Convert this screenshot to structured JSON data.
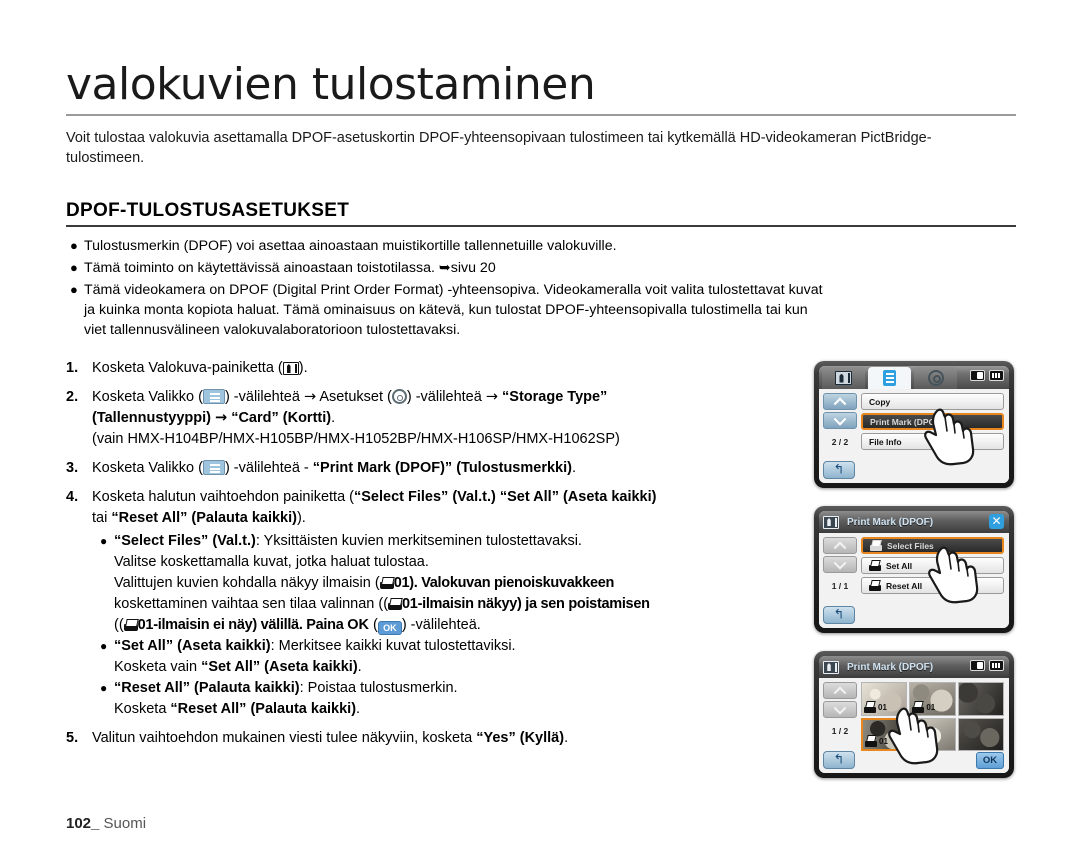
{
  "page": {
    "title": "valokuvien tulostaminen",
    "intro": "Voit tulostaa valokuvia asettamalla DPOF-asetuskortin DPOF-yhteensopivaan tulostimeen tai kytkemällä HD-videokameran PictBridge-tulostimeen.",
    "section_heading": "DPOF-TULOSTUSASETUKSET",
    "footer_number": "102_",
    "footer_language": "Suomi"
  },
  "bullets": [
    "Tulostusmerkin (DPOF) voi asettaa ainoastaan muistikortille tallennetuille valokuville.",
    "Tämä toiminto on käytettävissä ainoastaan toistotilassa. ➥sivu 20",
    "Tämä videokamera on DPOF (Digital Print Order Format) -yhteensopiva. Videokameralla voit valita tulostettavat kuvat ja kuinka monta kopiota haluat. Tämä ominaisuus on kätevä, kun tulostat DPOF-yhteensopivalla tulostimella tai kun viet tallennusvälineen valokuvalaboratorioon tulostettavaksi."
  ],
  "steps": {
    "s1": {
      "num": "1.",
      "a": "Kosketa Valokuva-painiketta (",
      "b": ")."
    },
    "s2": {
      "num": "2.",
      "a": "Kosketa Valikko (",
      "b": ") -välilehteä ",
      "arrow1": "→",
      "c": " Asetukset (",
      "d": ") -välilehteä ",
      "arrow2": "→",
      "e": " ",
      "bold1": "“Storage Type”",
      "bold2": "(Tallennustyyppi)",
      "arrow3": "→",
      "bold3": "“Card”",
      "bold4": "(Kortti)",
      "dot": ".",
      "models": "(vain HMX-H104BP/HMX-H105BP/HMX-H1052BP/HMX-H106SP/HMX-H1062SP)"
    },
    "s3": {
      "num": "3.",
      "a": "Kosketa Valikko (",
      "b": ") -välilehteä - ",
      "bold1": "“Print Mark (DPOF)”",
      "bold2": "(Tulostusmerkki)",
      "dot": "."
    },
    "s4": {
      "num": "4.",
      "a": "Kosketa halutun vaihtoehdon painiketta (",
      "bold1": "“Select Files” (Val.t.)",
      "bold2": "“Set All” (Aseta kaikki)",
      "mid": " tai ",
      "bold3": "“Reset All” (Palauta kaikki)",
      "end": ").",
      "sub": [
        {
          "bold": "“Select Files” (Val.t.)",
          "rest": ": Yksittäisten kuvien merkitseminen tulostettavaksi.",
          "line2": "Valitse koskettamalla kuvat, jotka haluat tulostaa.",
          "line3a": "Valittujen kuvien kohdalla näkyy ilmaisin (",
          "line3b": "01). Valokuvan pienoiskuvakkeen",
          "line4a": "koskettaminen vaihtaa sen tilaa valinnan ((",
          "line4b": "01-ilmaisin näkyy) ja sen poistamisen",
          "line5a": "((",
          "line5b": "01-ilmaisin ei näy) välillä. Paina ",
          "line5bold": "OK",
          "line5c": " (",
          "line5d": ") -välilehteä."
        },
        {
          "bold": "“Set All” (Aseta kaikki)",
          "rest": ": Merkitsee kaikki kuvat tulostettaviksi.",
          "line2a": "Kosketa vain ",
          "line2bold": "“Set All” (Aseta kaikki)",
          "line2c": "."
        },
        {
          "bold": "“Reset All” (Palauta kaikki)",
          "rest": ": Poistaa tulostusmerkin.",
          "line2a": "Kosketa ",
          "line2bold": "“Reset All” (Palauta kaikki)",
          "line2c": "."
        }
      ]
    },
    "s5": {
      "num": "5.",
      "a": "Valitun vaihtoehdon mukainen viesti tulee näkyviin, kosketa ",
      "bold1": "“Yes” (Kyllä)",
      "dot": "."
    }
  },
  "lcd1": {
    "tabs": [
      {
        "icon": "photo-mode-icon",
        "active": false
      },
      {
        "icon": "menu-icon",
        "active": true
      },
      {
        "icon": "settings-gear-icon",
        "active": false
      }
    ],
    "status_icons": [
      "card-icon",
      "battery-icon"
    ],
    "page_count": "2 / 2",
    "items": [
      {
        "label": "Copy",
        "selected": false
      },
      {
        "label": "Print Mark (DPOF)",
        "selected": true
      },
      {
        "label": "File Info",
        "selected": false
      }
    ],
    "back_icon": "back-arrow-icon"
  },
  "lcd2": {
    "title": "Print Mark (DPOF)",
    "close_icon": "close-icon",
    "page_count": "1 / 1",
    "items": [
      {
        "label": "Select Files",
        "selected": true
      },
      {
        "label": "Set All",
        "selected": false
      },
      {
        "label": "Reset All",
        "selected": false
      }
    ],
    "back_icon": "back-arrow-icon"
  },
  "lcd3": {
    "title": "Print Mark (DPOF)",
    "status_icons": [
      "card-icon",
      "battery-icon"
    ],
    "page_count": "1 / 2",
    "ok_label": "OK",
    "back_icon": "back-arrow-icon",
    "thumbnails": [
      {
        "mark": "01",
        "selected": false
      },
      {
        "mark": "01",
        "selected": false
      },
      {
        "mark": "",
        "selected": false
      },
      {
        "mark": "01",
        "selected": true
      },
      {
        "mark": "",
        "selected": false
      },
      {
        "mark": "",
        "selected": false
      }
    ]
  },
  "colors": {
    "accent_orange": "#e8861e",
    "accent_blue": "#2f9fe0",
    "rule_gray": "#9a9a9a"
  }
}
